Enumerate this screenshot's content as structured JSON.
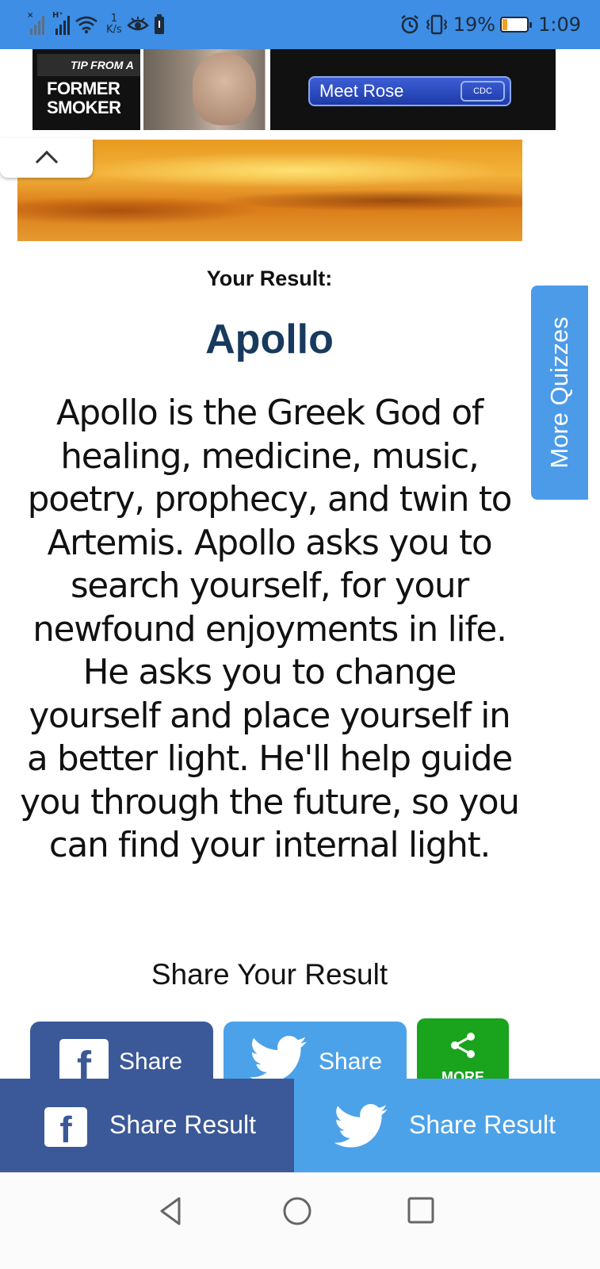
{
  "status_bar": {
    "net_speed_value": "1",
    "net_speed_unit": "K/s",
    "signal1_tag": "×",
    "signal2_tag": "H⁺",
    "battery_percent": "19%",
    "time": "1:09",
    "icons": [
      "signal-icon",
      "wifi-icon",
      "eye-icon",
      "battery-saver-icon",
      "alarm-icon",
      "vibrate-icon",
      "battery-icon"
    ]
  },
  "ad": {
    "small_text": "TIP FROM A",
    "headline_line1": "FORMER",
    "headline_line2": "SMOKER",
    "cta": "Meet Rose",
    "badge": "CDC"
  },
  "result": {
    "label": "Your Result:",
    "name": "Apollo",
    "description": "Apollo is the Greek God of healing, medicine, music, poetry, prophecy, and twin to Artemis. Apollo asks you to search yourself, for your newfound enjoyments in life. He asks you to change yourself and place yourself in a better light. He'll help guide you through the future, so you can find your internal light."
  },
  "side_tab": {
    "label": "More Quizzes"
  },
  "share": {
    "title": "Share Your Result",
    "facebook_label": "Share",
    "twitter_label": "Share",
    "more_label": "MORE"
  },
  "sticky_share": {
    "facebook_label": "Share Result",
    "twitter_label": "Share Result"
  },
  "colors": {
    "status_bar": "#3d8ee4",
    "facebook": "#3b5998",
    "twitter": "#4ca2e9",
    "more_share": "#1aa31c",
    "result_name": "#173a5e",
    "side_tab": "#4b9be8"
  }
}
